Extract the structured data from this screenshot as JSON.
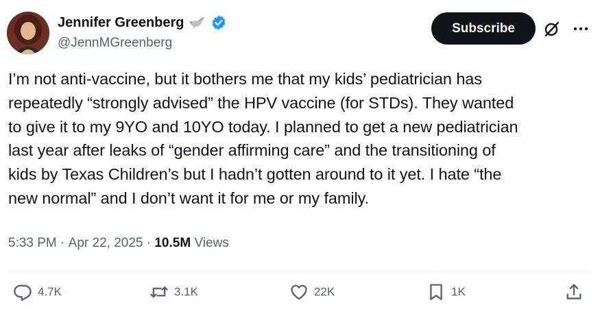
{
  "author": {
    "display_name": "Jennifer Greenberg",
    "handle": "@JennMGreenberg",
    "emoji_icon": "dove-emoji-icon",
    "verified": true,
    "verified_color": "#1d9bf0"
  },
  "header": {
    "subscribe_label": "Subscribe",
    "grok_icon": "grok-icon",
    "more_icon": "more-icon"
  },
  "tweet": {
    "text": "I’m not anti-vaccine, but it bothers me that my kids’ pediatrician has\nrepeatedly “strongly advised” the HPV vaccine (for STDs). They wanted\nto give it to my 9YO and 10YO today. I planned to get a new pediatrician\nlast year after leaks of “gender affirming care” and the transitioning of\nkids by Texas Children’s but I hadn’t gotten around to it yet. I hate “the\nnew normal” and I don’t want it for me or my family."
  },
  "meta": {
    "time": "5:33 PM",
    "sep1": " · ",
    "date": "Apr 22, 2025",
    "sep2": " · ",
    "views_count": "10.5M",
    "views_label": " Views"
  },
  "actions": {
    "replies": "4.7K",
    "reposts": "3.1K",
    "likes": "22K",
    "bookmarks": "1K"
  },
  "colors": {
    "text_primary": "#0f1419",
    "text_secondary": "#536471",
    "button_bg": "#0f1419",
    "divider": "#eff3f4"
  }
}
